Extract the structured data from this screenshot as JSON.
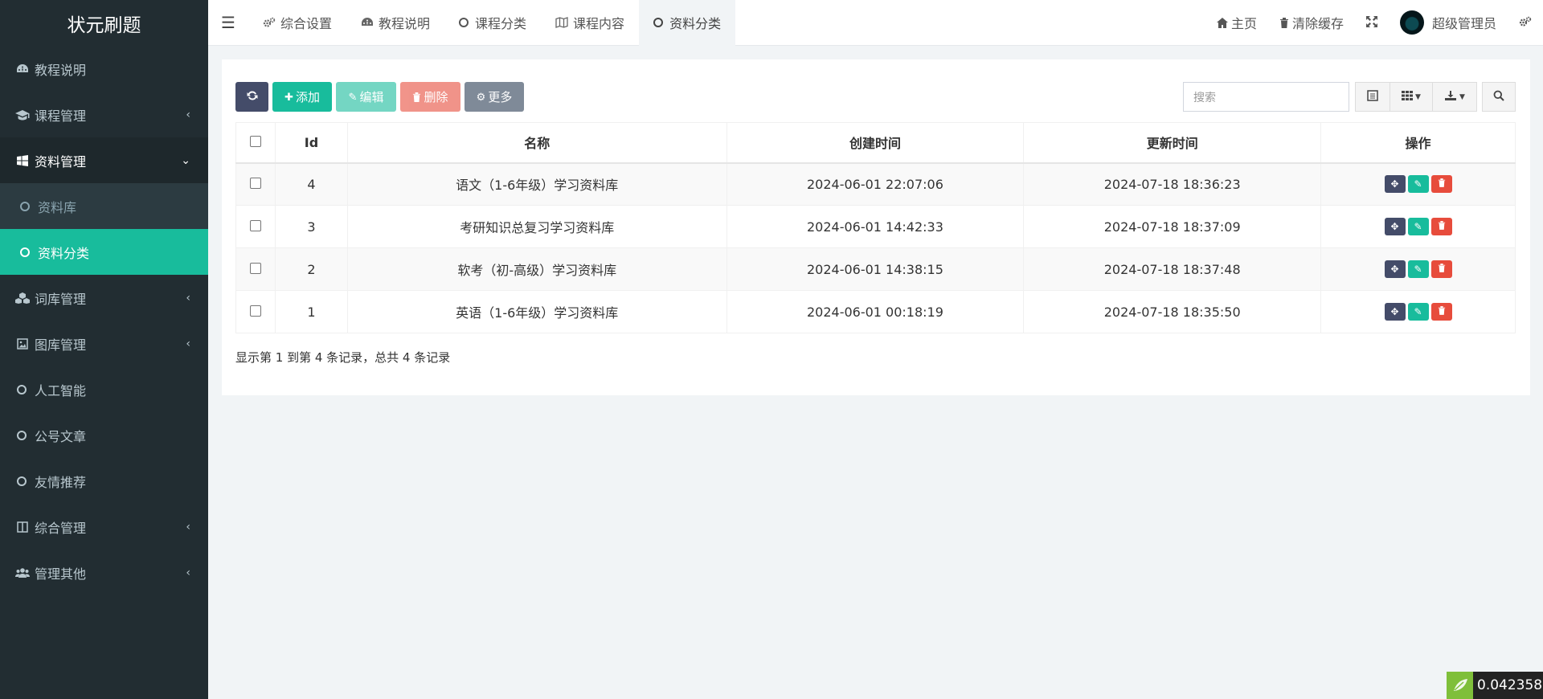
{
  "app": {
    "title": "状元刷题"
  },
  "sidebar": {
    "items": [
      {
        "label": "教程说明",
        "icon": "dashboard-icon"
      },
      {
        "label": "课程管理",
        "icon": "graduation-cap-icon",
        "caret": "‹"
      },
      {
        "label": "资料管理",
        "icon": "windows-icon",
        "caret": "⌄",
        "children": [
          {
            "label": "资料库"
          },
          {
            "label": "资料分类",
            "active": true
          }
        ]
      },
      {
        "label": "词库管理",
        "icon": "cubes-icon",
        "caret": "‹"
      },
      {
        "label": "图库管理",
        "icon": "image-icon",
        "caret": "‹"
      },
      {
        "label": "人工智能",
        "icon": "circle-icon"
      },
      {
        "label": "公号文章",
        "icon": "circle-icon"
      },
      {
        "label": "友情推荐",
        "icon": "circle-icon"
      },
      {
        "label": "综合管理",
        "icon": "columns-icon",
        "caret": "‹"
      },
      {
        "label": "管理其他",
        "icon": "users-icon",
        "caret": "‹"
      }
    ]
  },
  "navbar": {
    "tabs": [
      {
        "label": "综合设置",
        "icon": "gears-icon"
      },
      {
        "label": "教程说明",
        "icon": "dashboard-icon"
      },
      {
        "label": "课程分类",
        "icon": "circle-icon"
      },
      {
        "label": "课程内容",
        "icon": "map-icon"
      },
      {
        "label": "资料分类",
        "icon": "circle-icon",
        "active": true
      }
    ],
    "right": {
      "home": "主页",
      "clear_cache": "清除缓存",
      "user": "超级管理员"
    }
  },
  "toolbar": {
    "add": "添加",
    "edit": "编辑",
    "delete": "删除",
    "more": "更多",
    "search_placeholder": "搜索"
  },
  "table": {
    "columns": [
      "Id",
      "名称",
      "创建时间",
      "更新时间",
      "操作"
    ],
    "rows": [
      {
        "id": "4",
        "name": "语文（1-6年级）学习资料库",
        "created": "2024-06-01 22:07:06",
        "updated": "2024-07-18 18:36:23"
      },
      {
        "id": "3",
        "name": "考研知识总复习学习资料库",
        "created": "2024-06-01 14:42:33",
        "updated": "2024-07-18 18:37:09"
      },
      {
        "id": "2",
        "name": "软考（初-高级）学习资料库",
        "created": "2024-06-01 14:38:15",
        "updated": "2024-07-18 18:37:48"
      },
      {
        "id": "1",
        "name": "英语（1-6年级）学习资料库",
        "created": "2024-06-01 00:18:19",
        "updated": "2024-07-18 18:35:50"
      }
    ]
  },
  "pager": {
    "summary": "显示第 1 到第 4 条记录，总共 4 条记录"
  },
  "debug": {
    "timer": "0.042358s"
  },
  "colors": {
    "sidebar_bg": "#222d32",
    "accent": "#18bc9c",
    "danger": "#e74c3c",
    "dark_btn": "#444c69"
  }
}
